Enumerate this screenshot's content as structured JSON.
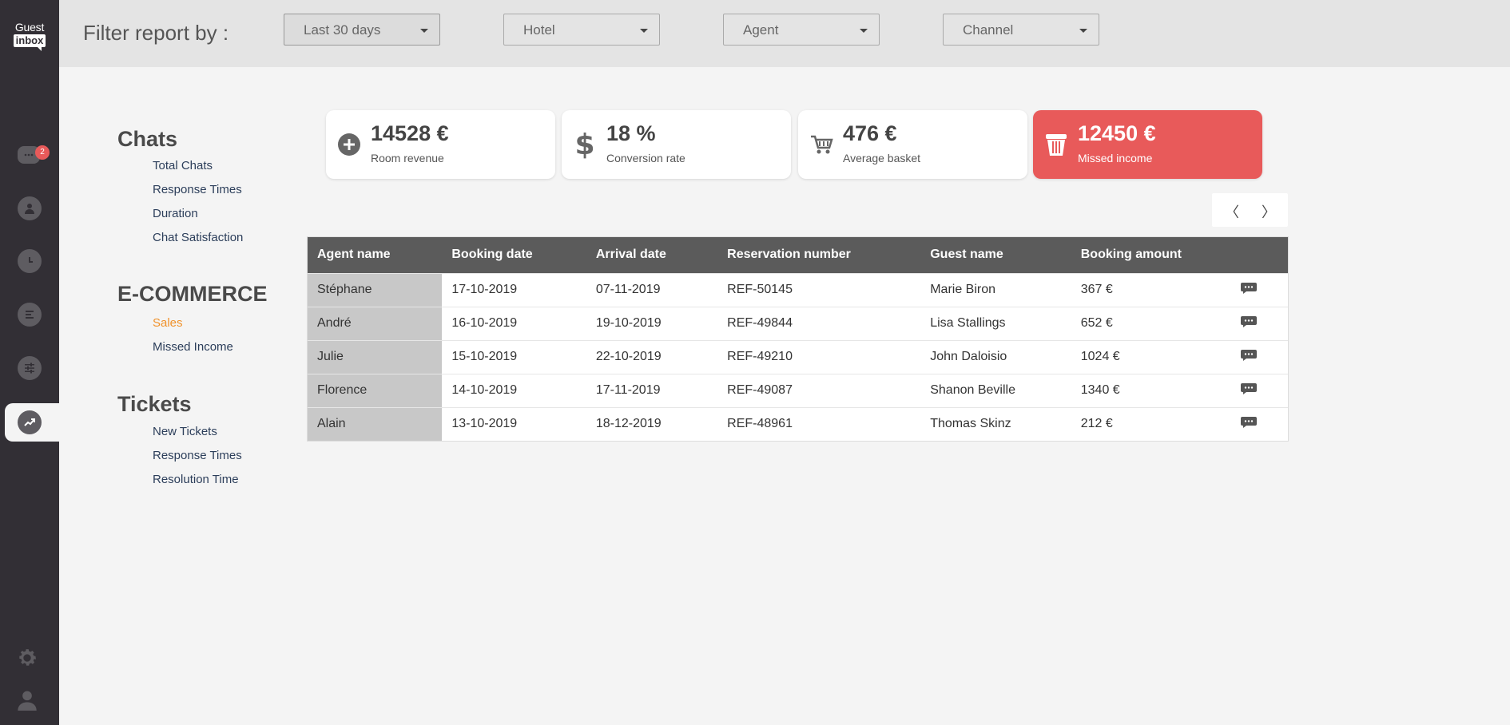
{
  "app": {
    "logo_top": "Guest",
    "logo_bottom": "inbox",
    "chat_badge": "2"
  },
  "filters": {
    "label": "Filter report by :",
    "date": "Last 30 days",
    "hotel": "Hotel",
    "agent": "Agent",
    "channel": "Channel"
  },
  "menu": {
    "chats": {
      "title": "Chats",
      "items": [
        "Total Chats",
        "Response Times",
        "Duration",
        "Chat Satisfaction"
      ]
    },
    "ecommerce": {
      "title": "E-COMMERCE",
      "items": [
        "Sales",
        "Missed Income"
      ],
      "active": "Sales"
    },
    "tickets": {
      "title": "Tickets",
      "items": [
        "New Tickets",
        "Response Times",
        "Resolution Time"
      ]
    }
  },
  "stats": [
    {
      "value": "14528 €",
      "label": "Room revenue",
      "icon": "plus-circle-icon"
    },
    {
      "value": "18 %",
      "label": "Conversion rate",
      "icon": "dollar-icon"
    },
    {
      "value": "476 €",
      "label": "Average basket",
      "icon": "cart-icon"
    },
    {
      "value": "12450 €",
      "label": "Missed income",
      "icon": "bucket-icon",
      "highlight_color": "#e85a5a"
    }
  ],
  "pager": {
    "prev": "〈",
    "next": "〉"
  },
  "table": {
    "headers": [
      "Agent name",
      "Booking date",
      "Arrival date",
      "Reservation number",
      "Guest name",
      "Booking amount"
    ],
    "rows": [
      [
        "Stéphane",
        "17-10-2019",
        "07-11-2019",
        "REF-50145",
        "Marie Biron",
        "367 €"
      ],
      [
        "André",
        "16-10-2019",
        "19-10-2019",
        "REF-49844",
        "Lisa Stallings",
        "652 €"
      ],
      [
        "Julie",
        "15-10-2019",
        "22-10-2019",
        "REF-49210",
        "John Daloisio",
        "1024 €"
      ],
      [
        "Florence",
        "14-10-2019",
        "17-11-2019",
        "REF-49087",
        "Shanon Beville",
        "1340 €"
      ],
      [
        "Alain",
        "13-10-2019",
        "18-12-2019",
        "REF-48961",
        "Thomas Skinz",
        "212 €"
      ]
    ]
  }
}
